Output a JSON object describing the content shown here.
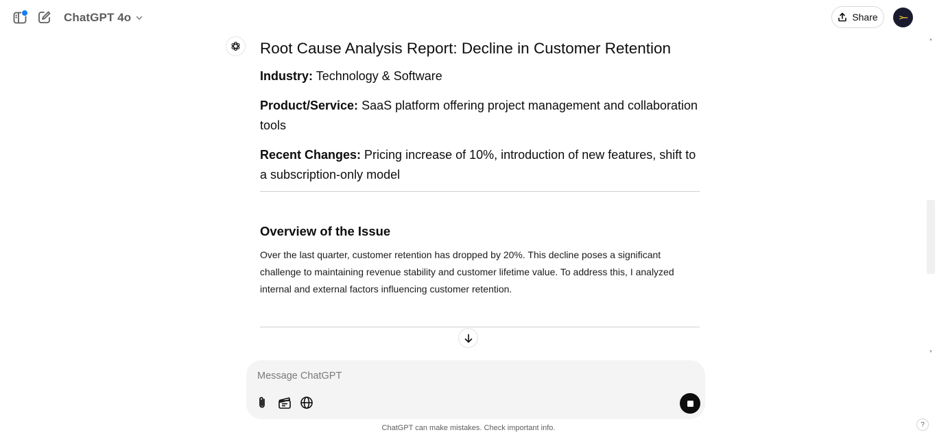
{
  "header": {
    "model_name": "ChatGPT 4o",
    "share_label": "Share",
    "avatar_glyph": ">–",
    "notification_color": "#1a7cf0"
  },
  "message": {
    "title": "Root Cause Analysis Report: Decline in Customer Retention",
    "fields": [
      {
        "label": "Industry:",
        "value": " Technology & Software"
      },
      {
        "label": "Product/Service:",
        "value": " SaaS platform offering project management and collaboration tools"
      },
      {
        "label": "Recent Changes:",
        "value": " Pricing increase of 10%, introduction of new features, shift to a subscription-only model"
      }
    ],
    "section": {
      "title": "Overview of the Issue",
      "body": "Over the last quarter, customer retention has dropped by 20%. This decline poses a significant challenge to maintaining revenue stability and customer lifetime value. To address this, I analyzed internal and external factors influencing customer retention."
    }
  },
  "composer": {
    "placeholder": "Message ChatGPT",
    "value": "",
    "tools": [
      "paperclip-icon",
      "clapperboard-icon",
      "globe-icon"
    ],
    "stop_icon": "stop-icon"
  },
  "footer": {
    "disclaimer": "ChatGPT can make mistakes. Check important info.",
    "help_label": "?"
  }
}
